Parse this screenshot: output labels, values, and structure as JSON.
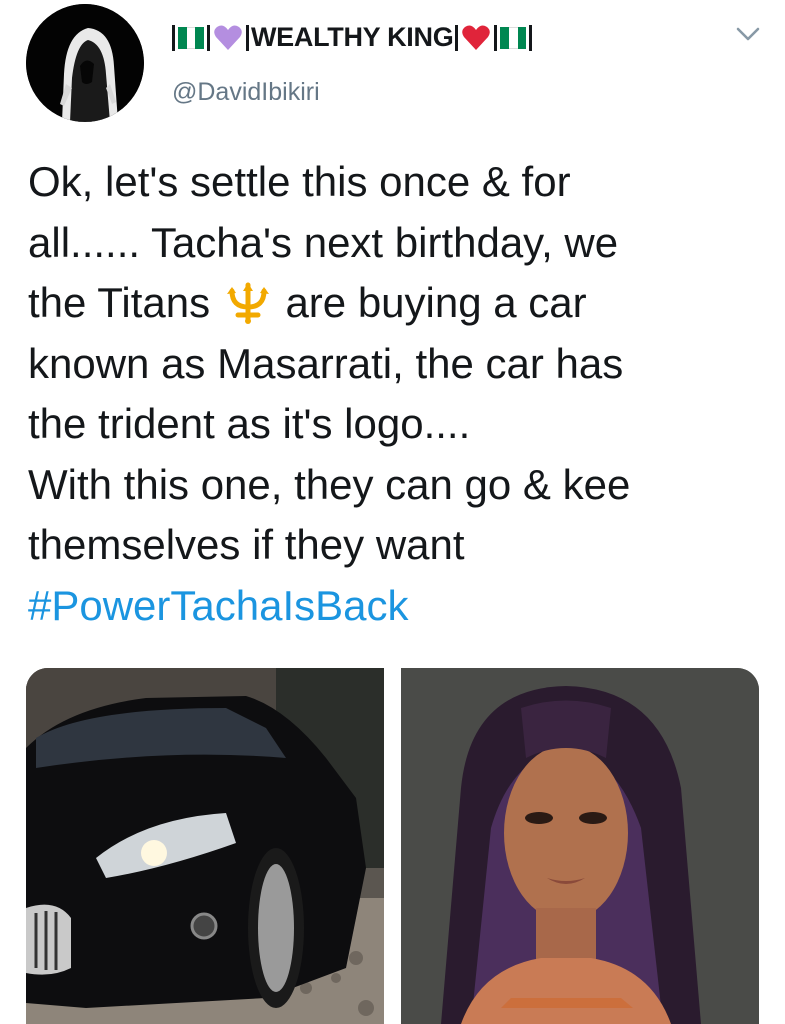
{
  "tweet": {
    "author": {
      "display_name_parts": [
        "WEALTHY KING"
      ],
      "handle": "@DavidIbikiri",
      "avatar_icon": "hooded-figure-avatar"
    },
    "text_lines": [
      "Ok, let's settle this once & for",
      "all...... Tacha's next birthday, we",
      "the Titans",
      "are buying a car",
      "known as Masarrati, the car has",
      "the trident as it's logo....",
      "With this one, they can go & kee",
      "themselves if they want"
    ],
    "hashtag": "#PowerTachaIsBack",
    "emoji": "trident-emoji",
    "media": [
      {
        "name": "black-maserati-car-photo"
      },
      {
        "name": "woman-portrait-photo"
      }
    ],
    "colors": {
      "text": "#14171a",
      "secondary": "#657786",
      "link": "#1b95e0",
      "flag_green": "#008751",
      "heart_purple": "#b48ee0",
      "heart_red": "#e0243a"
    }
  }
}
